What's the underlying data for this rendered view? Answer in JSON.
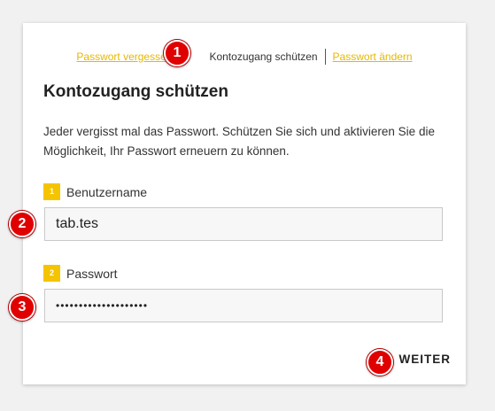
{
  "breadcrumb": {
    "link_left": "Passwort vergessen",
    "current": "Kontozugang schützen",
    "link_right": "Passwort ändern"
  },
  "page_title": "Kontozugang schützen",
  "description": "Jeder vergisst mal das Passwort. Schützen Sie sich und aktivieren Sie die Möglichkeit, Ihr Passwort erneuern zu können.",
  "fields": [
    {
      "badge": "1",
      "label": "Benutzername",
      "value": "tab.tes"
    },
    {
      "badge": "2",
      "label": "Passwort",
      "value": "••••••••••••••••••••"
    }
  ],
  "actions": {
    "next_label": "WEITER"
  },
  "annotations": [
    "1",
    "2",
    "3",
    "4"
  ],
  "colors": {
    "accent": "#f5c400",
    "link": "#e6b800",
    "marker": "#e00000"
  }
}
